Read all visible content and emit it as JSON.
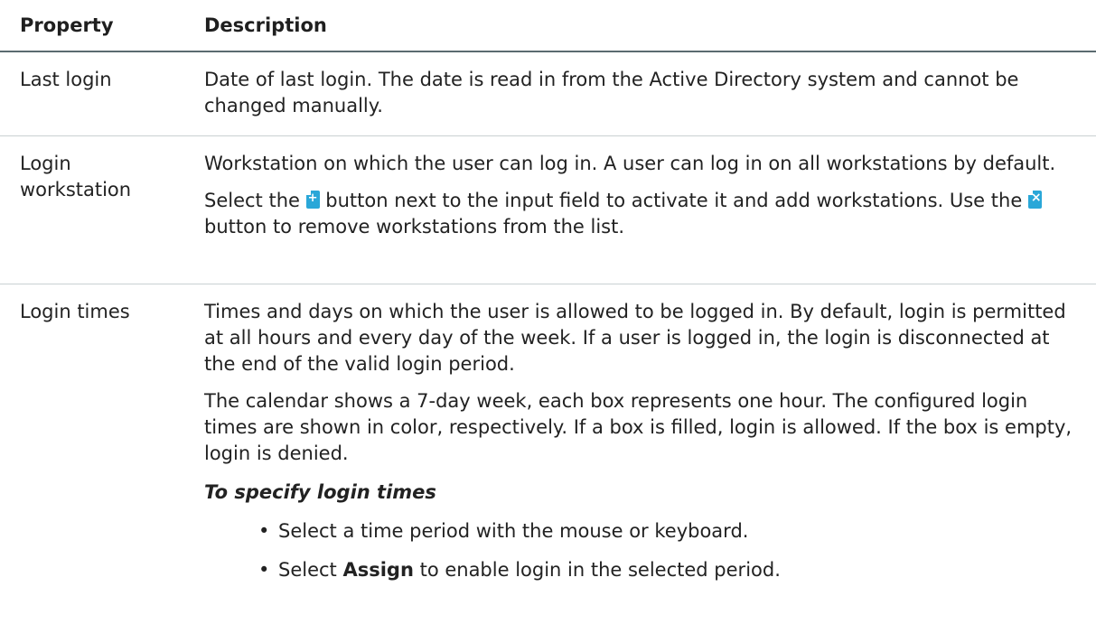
{
  "table": {
    "headers": {
      "property": "Property",
      "description": "Description"
    },
    "rows": [
      {
        "property": "Last login",
        "description": "Date of last login. The date is read in from the Active Directory system and cannot be changed manually."
      },
      {
        "property": "Login workstation",
        "p1": "Workstation on which the user can log in. A user can log in on all workstations by default.",
        "p2_a": "Select the ",
        "p2_b": " button next to the input field to activate it and add workstations. Use the ",
        "p2_c": " button to remove workstations from the list.",
        "icons": [
          "add-icon",
          "remove-icon"
        ]
      },
      {
        "property": "Login times",
        "p1": "Times and days on which the user is allowed to be logged in. By default, login is permitted at all hours and every day of the week. If a user is logged in, the login is disconnected at the end of the valid login period.",
        "p2": "The calendar shows a 7-day week, each box represents one hour. The configured login times are shown in color, respectively. If a box is filled, login is allowed. If the box is empty, login is denied.",
        "procedure_title": "To specify login times",
        "bullets": [
          {
            "text": "Select a time period with the mouse or keyboard."
          },
          {
            "pre": "Select ",
            "bold": "Assign",
            "post": " to enable login in the selected period."
          }
        ]
      }
    ]
  },
  "colors": {
    "header_rule": "#5b6b70",
    "row_rule": "#c9d0d2",
    "icon_blue": "#2aa7d8"
  }
}
